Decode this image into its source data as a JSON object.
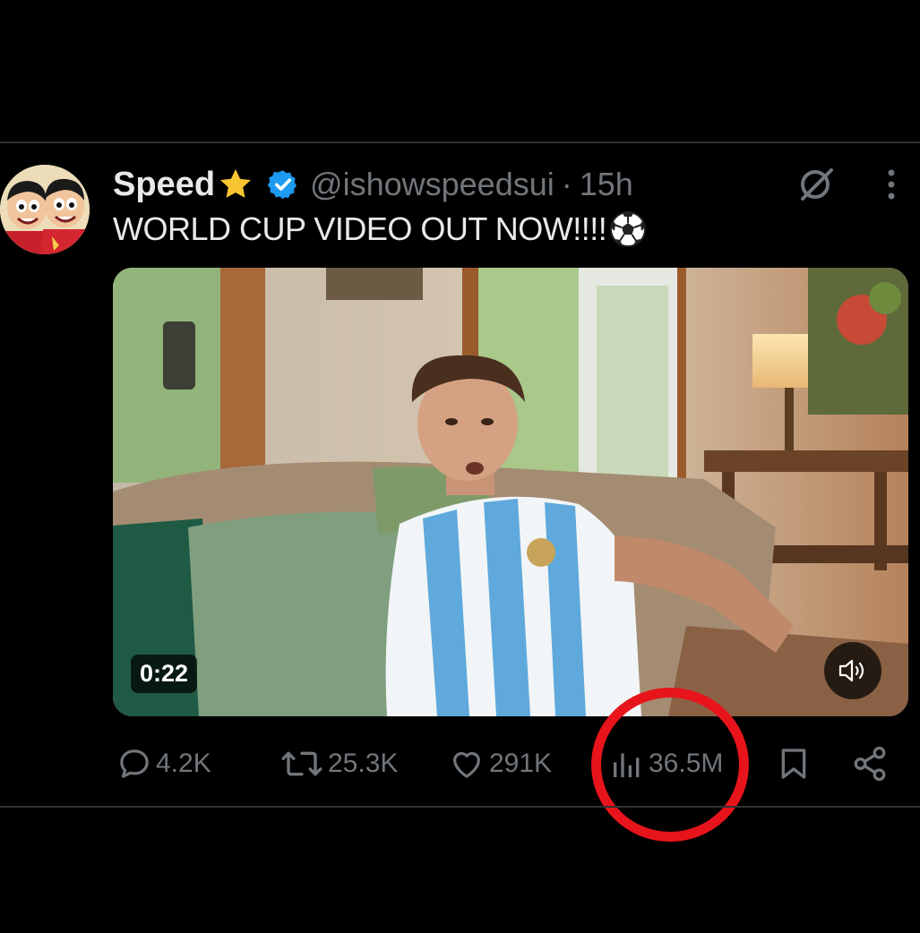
{
  "tweet": {
    "display_name": "Speed",
    "handle": "@ishowspeedsui",
    "separator": "·",
    "timestamp": "15h",
    "text": "WORLD CUP VIDEO OUT NOW!!!!"
  },
  "video": {
    "duration": "0:22"
  },
  "actions": {
    "replies": "4.2K",
    "reposts": "25.3K",
    "likes": "291K",
    "views": "36.5M"
  },
  "icons": {
    "name_badge": "star-icon",
    "verified": "verified-badge-icon",
    "text_emoji": "soccer-ball-icon",
    "grok": "grok-icon",
    "more": "more-vertical-icon",
    "reply": "reply-icon",
    "repost": "repost-icon",
    "like": "heart-icon",
    "views": "views-chart-icon",
    "bookmark": "bookmark-icon",
    "share": "share-icon",
    "volume": "volume-icon"
  },
  "colors": {
    "background": "#000000",
    "text_primary": "#e7e9ea",
    "text_secondary": "#71767b",
    "verified_blue": "#1d9bf0",
    "highlight_red": "#e8141b"
  }
}
